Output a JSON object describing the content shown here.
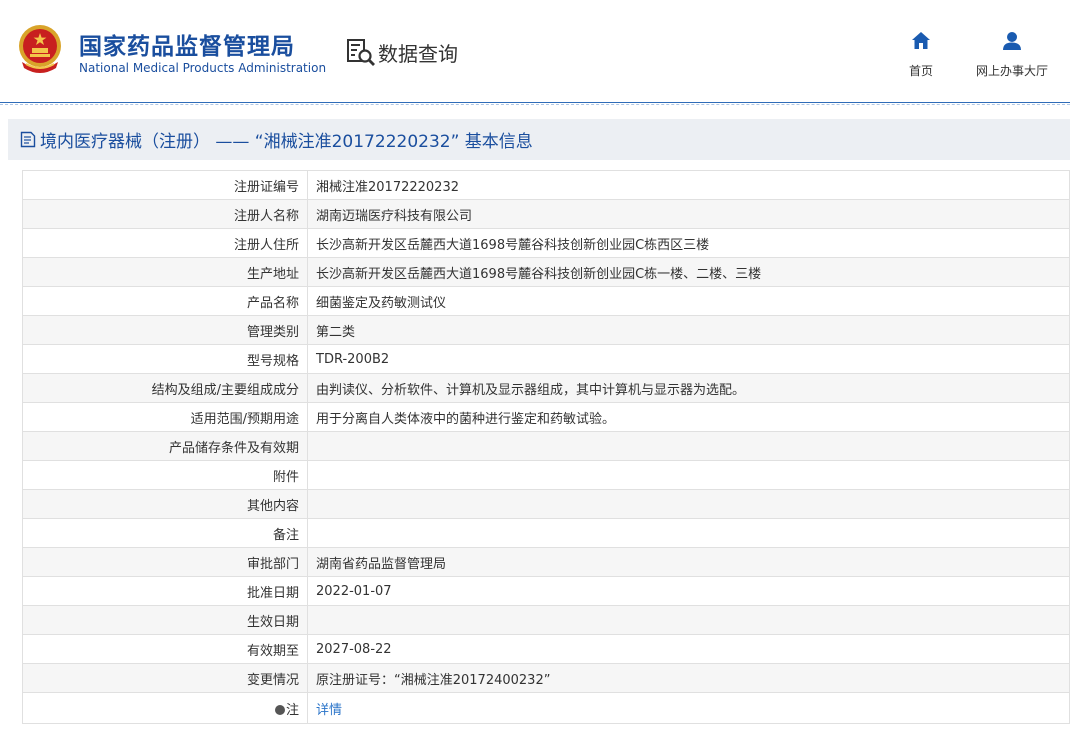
{
  "brand": {
    "name_cn": "国家药品监督管理局",
    "name_en": "National Medical Products Administration"
  },
  "header": {
    "data_query_label": "数据查询",
    "nav": [
      {
        "label": "首页",
        "icon": "home-icon"
      },
      {
        "label": "网上办事大厅",
        "icon": "user-icon"
      }
    ]
  },
  "colors": {
    "brand_blue": "#1a4e9e",
    "link_blue": "#2a74c9",
    "title_bg": "#eceff3"
  },
  "page": {
    "title": "境内医疗器械（注册） —— “湘械注准20172220232” 基本信息"
  },
  "record": {
    "fields": [
      {
        "label": "注册证编号",
        "value": "湘械注准20172220232"
      },
      {
        "label": "注册人名称",
        "value": "湖南迈瑞医疗科技有限公司"
      },
      {
        "label": "注册人住所",
        "value": "长沙高新开发区岳麓西大道1698号麓谷科技创新创业园C栋西区三楼"
      },
      {
        "label": "生产地址",
        "value": "长沙高新开发区岳麓西大道1698号麓谷科技创新创业园C栋一楼、二楼、三楼"
      },
      {
        "label": "产品名称",
        "value": "细菌鉴定及药敏测试仪"
      },
      {
        "label": "管理类别",
        "value": "第二类"
      },
      {
        "label": "型号规格",
        "value": "TDR-200B2"
      },
      {
        "label": "结构及组成/主要组成成分",
        "value": "由判读仪、分析软件、计算机及显示器组成，其中计算机与显示器为选配。"
      },
      {
        "label": "适用范围/预期用途",
        "value": "用于分离自人类体液中的菌种进行鉴定和药敏试验。"
      },
      {
        "label": "产品储存条件及有效期",
        "value": ""
      },
      {
        "label": "附件",
        "value": ""
      },
      {
        "label": "其他内容",
        "value": ""
      },
      {
        "label": "备注",
        "value": ""
      },
      {
        "label": "审批部门",
        "value": "湖南省药品监督管理局"
      },
      {
        "label": "批准日期",
        "value": "2022-01-07"
      },
      {
        "label": "生效日期",
        "value": ""
      },
      {
        "label": "有效期至",
        "value": "2027-08-22"
      },
      {
        "label": "变更情况",
        "value": "原注册证号：“湘械注准20172400232”"
      }
    ],
    "note": {
      "label": "注",
      "link": "详情",
      "icon": "bulb-icon"
    }
  }
}
